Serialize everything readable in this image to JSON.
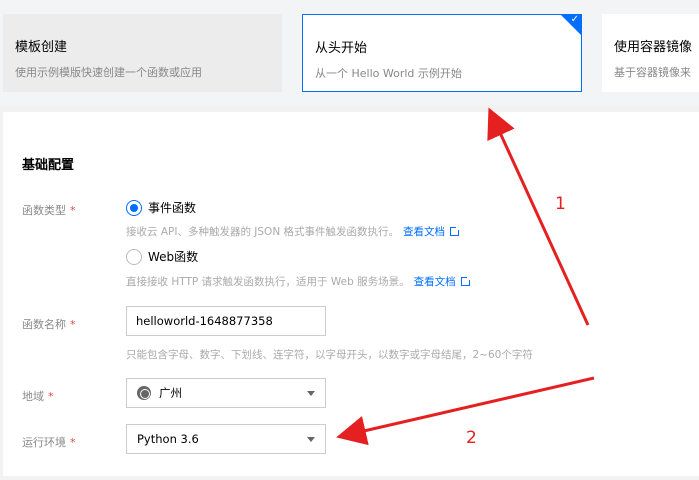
{
  "cards": [
    {
      "title": "模板创建",
      "subtitle": "使用示例模版快速创建一个函数或应用"
    },
    {
      "title": "从头开始",
      "subtitle": "从一个 Hello World 示例开始"
    },
    {
      "title": "使用容器镜像",
      "subtitle": "基于容器镜像来"
    }
  ],
  "section_title": "基础配置",
  "func_type": {
    "label": "函数类型",
    "required": "*",
    "option_event": "事件函数",
    "hint_event": "接收云 API、多种触发器的 JSON 格式事件触发函数执行。",
    "option_web": "Web函数",
    "hint_web": "直接接收 HTTP 请求触发函数执行，适用于 Web 服务场景。",
    "doc_link": "查看文档"
  },
  "func_name": {
    "label": "函数名称",
    "required": "*",
    "value": "helloworld-1648877358",
    "hint": "只能包含字母、数字、下划线、连字符，以字母开头，以数字或字母结尾，2~60个字符"
  },
  "region": {
    "label": "地域",
    "required": "*",
    "value": "广州"
  },
  "runtime": {
    "label": "运行环境",
    "required": "*",
    "value": "Python 3.6"
  },
  "annotations": {
    "a1": "1",
    "a2": "2"
  },
  "colors": {
    "accent": "#006eff",
    "annotation": "#e52020"
  }
}
